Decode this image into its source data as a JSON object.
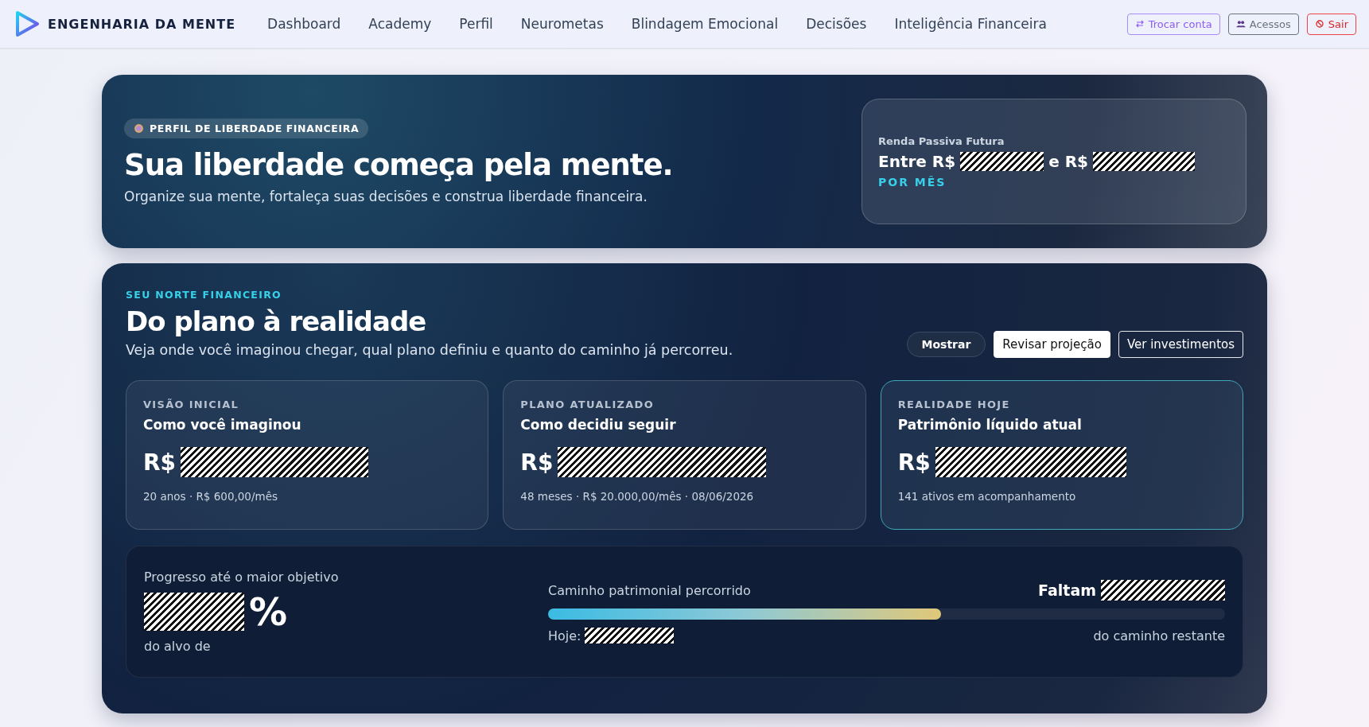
{
  "brand": {
    "name": "ENGENHARIA DA MENTE"
  },
  "nav": {
    "items": [
      {
        "label": "Dashboard",
        "selected": false
      },
      {
        "label": "Academy",
        "selected": false
      },
      {
        "label": "Perfil",
        "selected": false
      },
      {
        "label": "Neurometas",
        "selected": false
      },
      {
        "label": "Blindagem Emocional",
        "selected": false
      },
      {
        "label": "Decisões",
        "selected": false
      },
      {
        "label": "Inteligência Financeira",
        "selected": false
      }
    ],
    "actions": [
      {
        "label": "Trocar conta",
        "kind": "switch"
      },
      {
        "label": "Acessos",
        "kind": "users"
      },
      {
        "label": "Sair",
        "kind": "logout"
      }
    ]
  },
  "hero": {
    "badge": "PERFIL DE LIBERDADE FINANCEIRA",
    "title": "Sua liberdade começa pela mente.",
    "subtitle": "Organize sua mente, fortaleça suas decisões e construa liberdade financeira.",
    "income": {
      "label": "Renda Passiva Futura",
      "prefix": "Entre R$",
      "middle": "e R$",
      "period": "POR MÊS"
    }
  },
  "north": {
    "eyebrow": "SEU NORTE FINANCEIRO",
    "title": "Do plano à realidade",
    "subtitle": "Veja onde você imaginou chegar, qual plano definiu e quanto do caminho já percorreu.",
    "buttons": [
      {
        "label": "Mostrar",
        "kind": "pill"
      },
      {
        "label": "Revisar projeção",
        "kind": "solid"
      },
      {
        "label": "Ver investimentos",
        "kind": "outline"
      }
    ],
    "cards": [
      {
        "eyebrow": "VISÃO INICIAL",
        "title": "Como você imaginou",
        "currency": "R$",
        "note": "20 anos · R$ 600,00/mês",
        "selected": false
      },
      {
        "eyebrow": "PLANO ATUALIZADO",
        "title": "Como decidiu seguir",
        "currency": "R$",
        "note": "48 meses · R$ 20.000,00/mês · 08/06/2026",
        "selected": false
      },
      {
        "eyebrow": "REALIDADE HOJE",
        "title": "Patrimônio líquido atual",
        "currency": "R$",
        "note": "141 ativos em acompanhamento",
        "selected": true
      }
    ],
    "progress": {
      "label": "Progresso até o maior objetivo",
      "percent_sign": "%",
      "target_label": "do alvo de",
      "path_label": "Caminho patrimonial percorrido",
      "remaining_label": "Faltam",
      "today_label": "Hoje:",
      "remaining_note": "do caminho restante",
      "level": 0.58
    }
  }
}
